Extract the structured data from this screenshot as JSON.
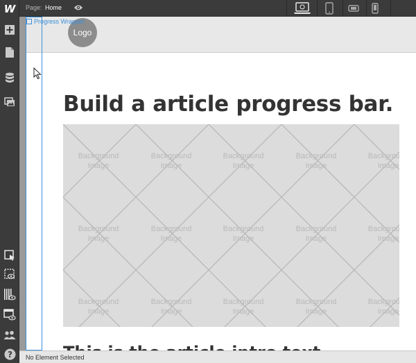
{
  "topbar": {
    "page_label": "Page:",
    "page_name": "Home",
    "devices": [
      "desktop",
      "tablet",
      "mobile-landscape",
      "mobile-portrait"
    ],
    "active_device": "desktop"
  },
  "rail": {
    "brand": "W",
    "top_tools": [
      "add-element-icon",
      "pages-icon",
      "cms-icon",
      "assets-icon"
    ],
    "bottom_tools": [
      "selector-icon",
      "preview-box-icon",
      "grid-preview-icon",
      "interactions-icon",
      "users-icon",
      "help-icon"
    ]
  },
  "canvas": {
    "selected_label": "Progress Wrapper",
    "logo_text": "Logo",
    "headline": "Build a article progress bar.",
    "hero_label_line1": "Background",
    "hero_label_line2": "Image",
    "intro": "This is the article intro text."
  },
  "status": {
    "text": "No Element Selected"
  },
  "colors": {
    "selection_blue": "#3a8fd9",
    "chrome_dark": "#3b3b3b",
    "hero_placeholder": "#dcdcdc"
  }
}
